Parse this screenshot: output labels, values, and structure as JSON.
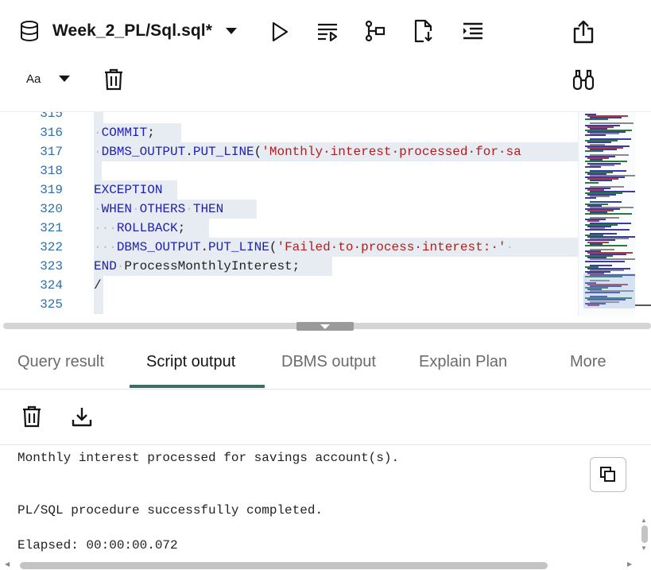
{
  "toolbar": {
    "file_name": "Week_2_PL/Sql.sql*",
    "font_size_label": "Aa",
    "icons": [
      "database-icon",
      "chevron-down-icon",
      "run-icon",
      "run-script-icon",
      "explain-plan-icon",
      "download-file-icon",
      "format-icon",
      "share-icon",
      "font-size-icon",
      "delete-icon",
      "binoculars-icon"
    ]
  },
  "editor": {
    "line_numbers": [
      "315",
      "316",
      "317",
      "318",
      "319",
      "320",
      "321",
      "322",
      "323",
      "324",
      "325"
    ],
    "lines": [
      {
        "segments": []
      },
      {
        "segments": [
          {
            "t": "dot",
            "v": "·"
          },
          {
            "t": "kw",
            "v": "COMMIT"
          },
          {
            "t": "plain",
            "v": ";"
          }
        ]
      },
      {
        "segments": [
          {
            "t": "dot",
            "v": "·"
          },
          {
            "t": "kw",
            "v": "DBMS_OUTPUT"
          },
          {
            "t": "plain",
            "v": "."
          },
          {
            "t": "kw",
            "v": "PUT_LINE"
          },
          {
            "t": "plain",
            "v": "("
          },
          {
            "t": "str",
            "v": "'Monthly·interest·processed·for·sa"
          }
        ]
      },
      {
        "segments": []
      },
      {
        "segments": [
          {
            "t": "kw",
            "v": "EXCEPTION"
          }
        ]
      },
      {
        "segments": [
          {
            "t": "dot",
            "v": "·"
          },
          {
            "t": "kw",
            "v": "WHEN"
          },
          {
            "t": "dot",
            "v": "·"
          },
          {
            "t": "kw",
            "v": "OTHERS"
          },
          {
            "t": "dot",
            "v": "·"
          },
          {
            "t": "kw",
            "v": "THEN"
          }
        ]
      },
      {
        "segments": [
          {
            "t": "dot",
            "v": "···"
          },
          {
            "t": "kw",
            "v": "ROLLBACK"
          },
          {
            "t": "plain",
            "v": ";"
          }
        ]
      },
      {
        "segments": [
          {
            "t": "dot",
            "v": "···"
          },
          {
            "t": "kw",
            "v": "DBMS_OUTPUT"
          },
          {
            "t": "plain",
            "v": "."
          },
          {
            "t": "kw",
            "v": "PUT_LINE"
          },
          {
            "t": "plain",
            "v": "("
          },
          {
            "t": "str",
            "v": "'Failed·to·process·interest:·'"
          },
          {
            "t": "dot",
            "v": "·"
          }
        ]
      },
      {
        "segments": [
          {
            "t": "kw",
            "v": "END"
          },
          {
            "t": "dot",
            "v": "·"
          },
          {
            "t": "plain",
            "v": "ProcessMonthlyInterest;"
          }
        ]
      },
      {
        "segments": [
          {
            "t": "plain",
            "v": "/"
          }
        ]
      },
      {
        "segments": []
      }
    ]
  },
  "tabs": [
    {
      "label": "Query result",
      "active": false
    },
    {
      "label": "Script output",
      "active": true
    },
    {
      "label": "DBMS output",
      "active": false
    },
    {
      "label": "Explain Plan",
      "active": false
    },
    {
      "label": "More",
      "active": false
    }
  ],
  "output": {
    "lines": [
      "Monthly interest processed for savings account(s).",
      "",
      "",
      "PL/SQL procedure successfully completed.",
      "",
      "Elapsed: 00:00:00.072"
    ]
  },
  "colors": {
    "keyword": "#1f1fb4",
    "string": "#b21d1d",
    "line_number": "#2a6fb0",
    "active_tab_underline": "#3c6e63",
    "selection": "#e6ecf2"
  }
}
